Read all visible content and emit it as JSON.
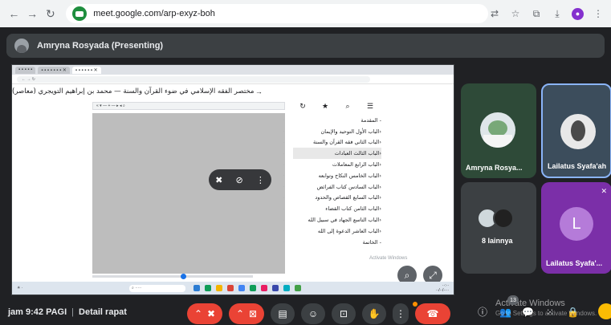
{
  "browser": {
    "url": "meet.google.com/arp-exyz-boh"
  },
  "presenting": {
    "label": "Amryna Rosyada (Presenting)"
  },
  "shared_screen": {
    "book_title": "مختصر الفقه الإسلامي في ضوء القرآن والسنة — محمد بن إبراهيم التويجري (معاصر)",
    "toc": [
      "- المقدمة",
      "‹الباب الأول التوحيد والإيمان",
      "‹الباب الثاني فقه القرآن والسنة",
      "‹الباب الثالث العبادات",
      "‹الباب الرابع المعاملات",
      "‹الباب الخامس النكاح وتوابعه",
      "‹الباب السادس كتاب الفرائض",
      "‹الباب السابع القصاص والحدود",
      "‹الباب الثامن كتاب القضاء",
      "‹الباب التاسع الجهاد في سبيل الله",
      "‹الباب العاشر الدعوة إلى الله",
      "- الخاتمة"
    ],
    "activate_windows": "Activate Windows"
  },
  "participants": {
    "tile1": "Amryna Rosya...",
    "tile2": "Lailatus Syafa'ah",
    "tile3": "8 lainnya",
    "tile4": "Lailatus Syafa'...",
    "tile4_letter": "L"
  },
  "footer": {
    "time": "jam 9:42 PAGI",
    "separator": "|",
    "details": "Detail rapat",
    "chat_count": "13",
    "activate_title": "Activate Windows",
    "activate_sub": "Go to Settings to activate Windows."
  },
  "colors": {
    "meet_bg": "#202124",
    "hangup": "#ea4335",
    "tile_purple": "#7b2fa8",
    "tile_green": "#2e4a38"
  }
}
